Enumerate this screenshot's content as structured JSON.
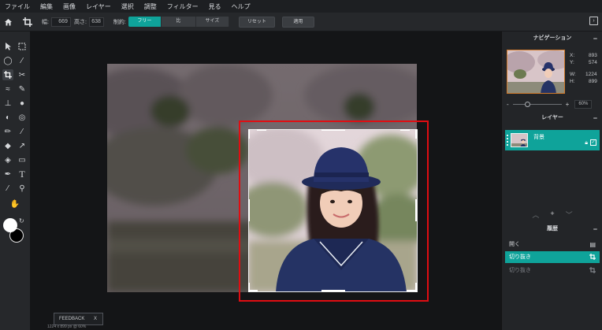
{
  "menubar": {
    "items": [
      "ファイル",
      "編集",
      "画像",
      "レイヤー",
      "選択",
      "調整",
      "フィルター",
      "見る",
      "ヘルプ"
    ]
  },
  "options": {
    "width_label": "幅:",
    "width_value": "669",
    "height_label": "高さ:",
    "height_value": "638",
    "constraint_label": "制約:",
    "constraint_options": [
      "フリー",
      "比",
      "サイズ"
    ],
    "constraint_selected": "フリー",
    "reset_label": "リセット",
    "apply_label": "適用",
    "home_icon": "home-icon",
    "crop_icon": "crop-icon",
    "panel_toggle_icon": "panel-toggle-icon"
  },
  "toolbar": {
    "tools": [
      "arrow-icon",
      "marquee-icon",
      "lasso-icon",
      "magic-wand-icon",
      "crop-icon",
      "scissors-icon",
      "liquify-icon",
      "heal-icon",
      "stamp-icon",
      "drop-icon",
      "dodge-icon",
      "spot-icon",
      "pencil-icon",
      "brush-icon",
      "eraser-icon",
      "smudge-icon",
      "bucket-icon",
      "shape-icon",
      "pen-icon",
      "text-icon",
      "eyedropper-icon",
      "zoom-icon",
      "hand-icon"
    ],
    "active_tool": "crop-icon",
    "primary_color": "#ffffff",
    "secondary_color": "#000000"
  },
  "canvas": {
    "feedback_label": "FEEDBACK",
    "feedback_close": "X",
    "status_text": "1224 x 899 px @ 60%",
    "highlight_color": "#e00d12"
  },
  "navigator": {
    "title": "ナビゲーション",
    "x_label": "X:",
    "x_value": "893",
    "y_label": "Y:",
    "y_value": "574",
    "w_label": "W:",
    "w_value": "1224",
    "h_label": "H:",
    "h_value": "899",
    "zoom_minus": "-",
    "zoom_plus": "+",
    "zoom_value": "60%",
    "zoom_fraction": 0.3
  },
  "layers": {
    "title": "レイヤー",
    "items": [
      {
        "name": "背景"
      }
    ],
    "accent": "#0fa39a"
  },
  "history": {
    "title": "履歴",
    "items": [
      {
        "label": "開く",
        "icon": "document-icon"
      },
      {
        "label": "切り抜き",
        "icon": "crop-icon"
      },
      {
        "label": "切り抜き",
        "icon": "crop-icon"
      }
    ],
    "active_index": 1
  }
}
